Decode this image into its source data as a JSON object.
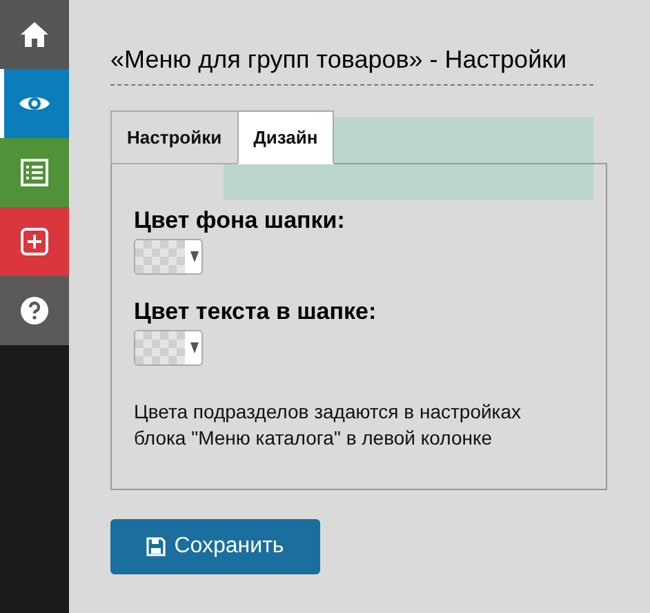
{
  "sidebar": {
    "items": [
      {
        "kind": "home",
        "selected": false
      },
      {
        "kind": "eye",
        "selected": true
      },
      {
        "kind": "list",
        "selected": false
      },
      {
        "kind": "plus",
        "selected": false
      },
      {
        "kind": "help",
        "selected": false
      }
    ]
  },
  "dialog": {
    "title": "«Меню для групп товаров» - Настройки",
    "tabs": [
      {
        "label": "Настройки",
        "selected": false
      },
      {
        "label": "Дизайн",
        "selected": true
      }
    ],
    "fields": [
      {
        "label": "Цвет фона шапки:"
      },
      {
        "label": "Цвет текста в шапке:"
      }
    ],
    "note": "Цвета подразделов задаются в настройках блока \"Меню каталога\" в левой колонке",
    "save_button": "Сохранить"
  }
}
